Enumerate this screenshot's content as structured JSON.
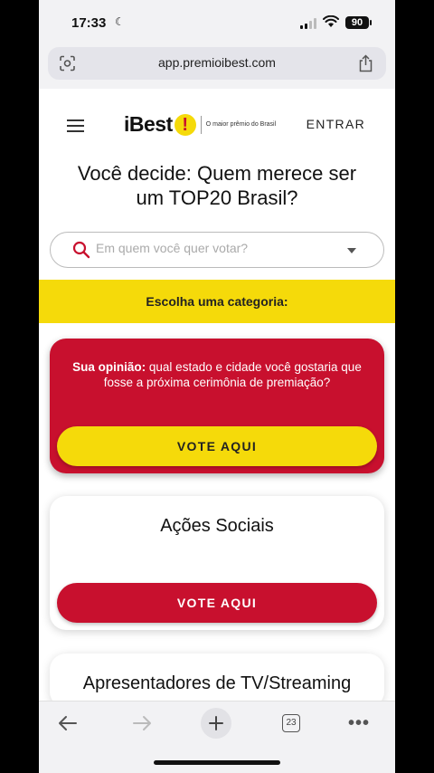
{
  "status_bar": {
    "time": "17:33",
    "battery": "90"
  },
  "browser": {
    "url": "app.premioibest.com"
  },
  "header": {
    "logo_text": "iBest",
    "tagline": "O maior prêmio do Brasil",
    "login_label": "ENTRAR"
  },
  "hero": {
    "title": "Você decide: Quem merece ser um TOP20 Brasil?"
  },
  "search": {
    "placeholder": "Em quem você quer votar?"
  },
  "category_bar": {
    "label": "Escolha uma categoria:"
  },
  "opinion_card": {
    "bold_text": "Sua opinião:",
    "text": " qual estado e cidade você gostaria que fosse a próxima cerimônia de premiação?",
    "button_label": "VOTE AQUI"
  },
  "categories": [
    {
      "title": "Ações Sociais",
      "button_label": "VOTE AQUI"
    },
    {
      "title": "Apresentadores de TV/Streaming"
    }
  ],
  "toolbar": {
    "tab_count": "23"
  },
  "colors": {
    "brand_red": "#c8102e",
    "brand_yellow": "#f5da0a"
  }
}
